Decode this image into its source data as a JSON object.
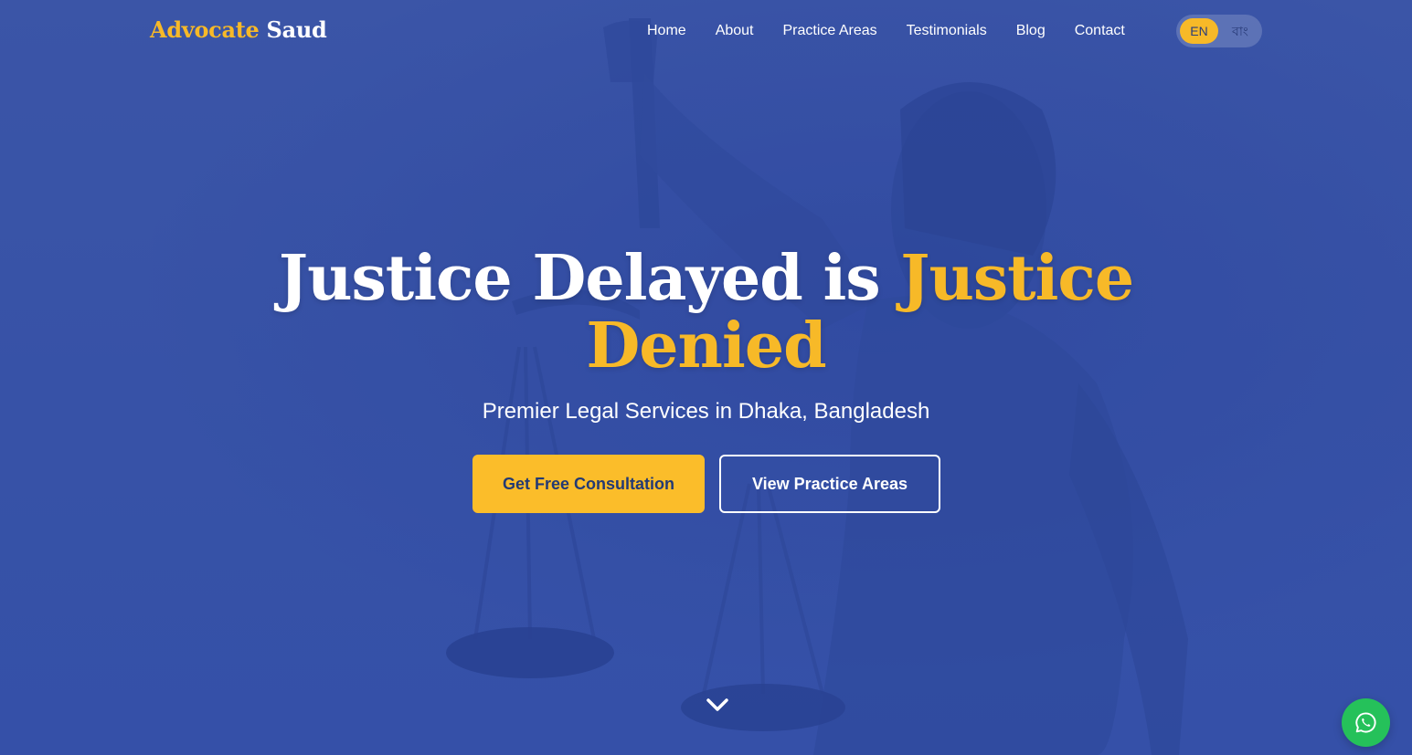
{
  "header": {
    "logo_first": "Advocate",
    "logo_second": "Saud",
    "nav": [
      {
        "label": "Home"
      },
      {
        "label": "About"
      },
      {
        "label": "Practice Areas"
      },
      {
        "label": "Testimonials"
      },
      {
        "label": "Blog"
      },
      {
        "label": "Contact"
      }
    ],
    "language": {
      "selected": "EN",
      "options": [
        "EN",
        "বাং"
      ]
    }
  },
  "hero": {
    "headline_plain": "Justice Delayed is ",
    "headline_accent_1": "Justice",
    "headline_accent_2": "Denied",
    "subtitle": "Premier Legal Services in Dhaka, Bangladesh",
    "primary_button": "Get Free Consultation",
    "secondary_button": "View Practice Areas"
  },
  "icons": {
    "scroll": "chevron-down-icon",
    "chat": "whatsapp-icon"
  },
  "colors": {
    "accent": "#f7b928",
    "background": "#3a55a6",
    "whatsapp": "#25c15a"
  }
}
